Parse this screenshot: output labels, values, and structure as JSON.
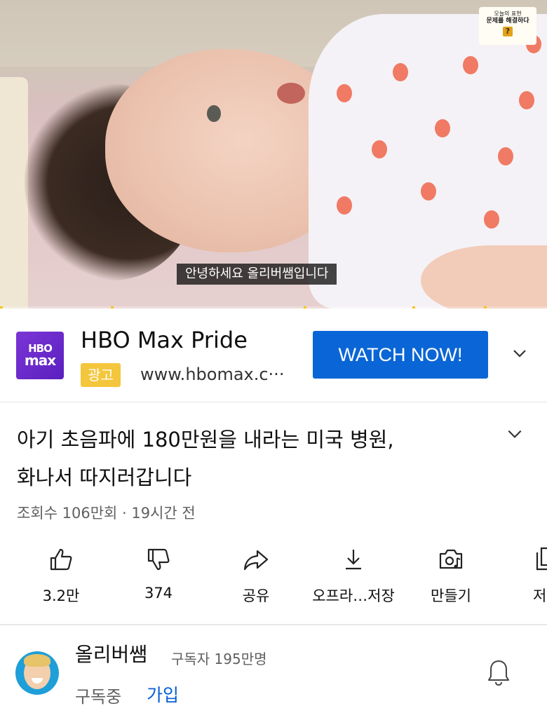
{
  "video": {
    "subtitle": "안녕하세요 올리버쌤입니다",
    "badge": {
      "line1": "오늘의 표현",
      "line2": "문제를 해결하다",
      "icon": "?"
    }
  },
  "ad": {
    "logo_top": "HBO",
    "logo_bottom": "max",
    "title": "HBO Max Pride",
    "tag": "광고",
    "url": "www.hbomax.c···",
    "cta": "WATCH NOW!",
    "accent": "#0a66d6",
    "tag_color": "#f4c63c"
  },
  "title": {
    "line1": "아기 초음파에 180만원을 내라는 미국 병원,",
    "line2": "화나서 따지러갑니다"
  },
  "meta": "조회수 106만회 · 19시간 전",
  "actions": [
    {
      "icon": "thumbs-up-icon",
      "label": "3.2만"
    },
    {
      "icon": "thumbs-down-icon",
      "label": "374"
    },
    {
      "icon": "share-icon",
      "label": "공유"
    },
    {
      "icon": "download-icon",
      "label": "오프라…저장"
    },
    {
      "icon": "create-icon",
      "label": "만들기"
    },
    {
      "icon": "save-icon",
      "label": "저"
    }
  ],
  "channel": {
    "name": "올리버쌤",
    "subscribers": "구독자 195만명",
    "subscribed": "구독중",
    "join": "가입"
  }
}
